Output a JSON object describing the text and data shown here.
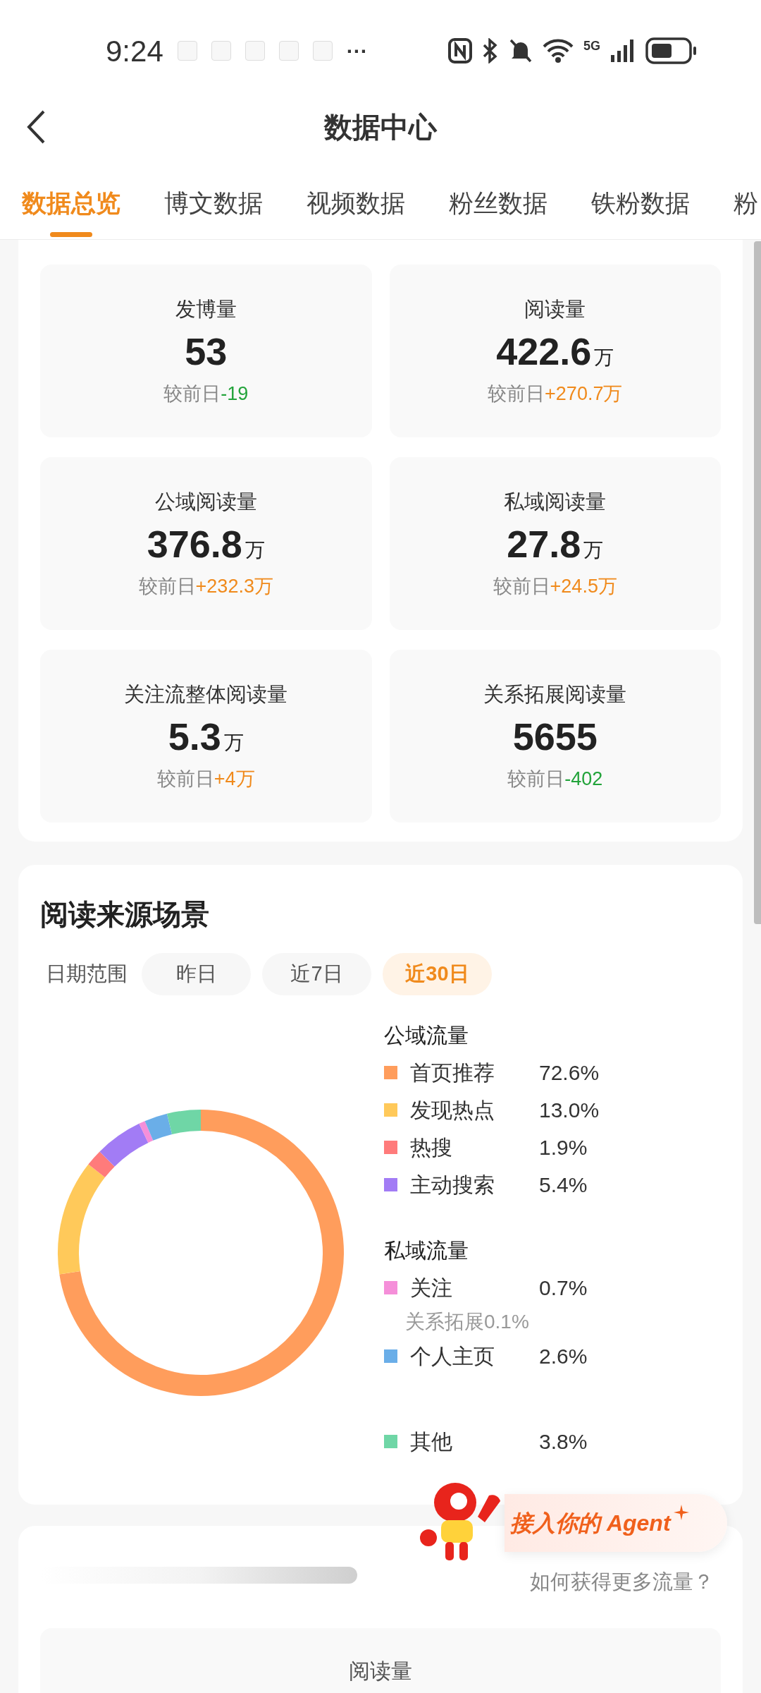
{
  "status_bar": {
    "time": "9:24",
    "more": "···",
    "network": "5G"
  },
  "header": {
    "title": "数据中心"
  },
  "tabs": [
    {
      "label": "数据总览",
      "selected": true
    },
    {
      "label": "博文数据",
      "selected": false
    },
    {
      "label": "视频数据",
      "selected": false
    },
    {
      "label": "粉丝数据",
      "selected": false
    },
    {
      "label": "铁粉数据",
      "selected": false
    },
    {
      "label": "粉",
      "selected": false
    }
  ],
  "stats": [
    {
      "label": "发博量",
      "value": "53",
      "delta_label": "较前日",
      "delta": "-19",
      "color": "#22a33a"
    },
    {
      "label": "阅读量",
      "value": "422.6",
      "unit": "万",
      "delta_label": "较前日",
      "delta": "+270.7万",
      "color": "#f08a1c"
    },
    {
      "label": "公域阅读量",
      "value": "376.8",
      "unit": "万",
      "delta_label": "较前日",
      "delta": "+232.3万",
      "color": "#f08a1c"
    },
    {
      "label": "私域阅读量",
      "value": "27.8",
      "unit": "万",
      "delta_label": "较前日",
      "delta": "+24.5万",
      "color": "#f08a1c"
    },
    {
      "label": "关注流整体阅读量",
      "value": "5.3",
      "unit": "万",
      "delta_label": "较前日",
      "delta": "+4万",
      "color": "#f08a1c"
    },
    {
      "label": "关系拓展阅读量",
      "value": "5655",
      "delta_label": "较前日",
      "delta": "-402",
      "color": "#22a33a"
    }
  ],
  "source": {
    "title": "阅读来源场景",
    "range_label": "日期范围",
    "ranges": [
      {
        "label": "昨日",
        "selected": false
      },
      {
        "label": "近7日",
        "selected": false
      },
      {
        "label": "近30日",
        "selected": true
      }
    ],
    "chart_data": {
      "type": "donut",
      "categories": [
        "首页推荐",
        "发现热点",
        "热搜",
        "主动搜索",
        "关注",
        "个人主页",
        "其他"
      ],
      "values": [
        72.6,
        13.0,
        1.9,
        5.4,
        0.7,
        2.6,
        3.8
      ]
    },
    "legend": [
      {
        "title": "公域流量",
        "items": [
          {
            "value": "72.6%",
            "color": "#ff9d5c"
          },
          {
            "value": "13.0%",
            "color": "#ffc95a"
          },
          {
            "value": "1.9%",
            "color": "#ff7b7b"
          },
          {
            "value": "5.4%",
            "color": "#a27cf5"
          }
        ]
      },
      {
        "title": "私域流量",
        "items": [
          {
            "value": "0.7%",
            "color": "#f58fd9",
            "note": "关系拓展0.1%"
          },
          {
            "value": "2.6%",
            "color": "#6aaee8"
          }
        ]
      },
      {
        "items": [
          {
            "value": "3.8%",
            "color": "#6fd6a6"
          }
        ]
      }
    ]
  },
  "traffic": {
    "link": "如何获得更多流量？",
    "tile_label": "阅读量"
  },
  "agent_banner": {
    "text": "接入你的 Agent"
  }
}
